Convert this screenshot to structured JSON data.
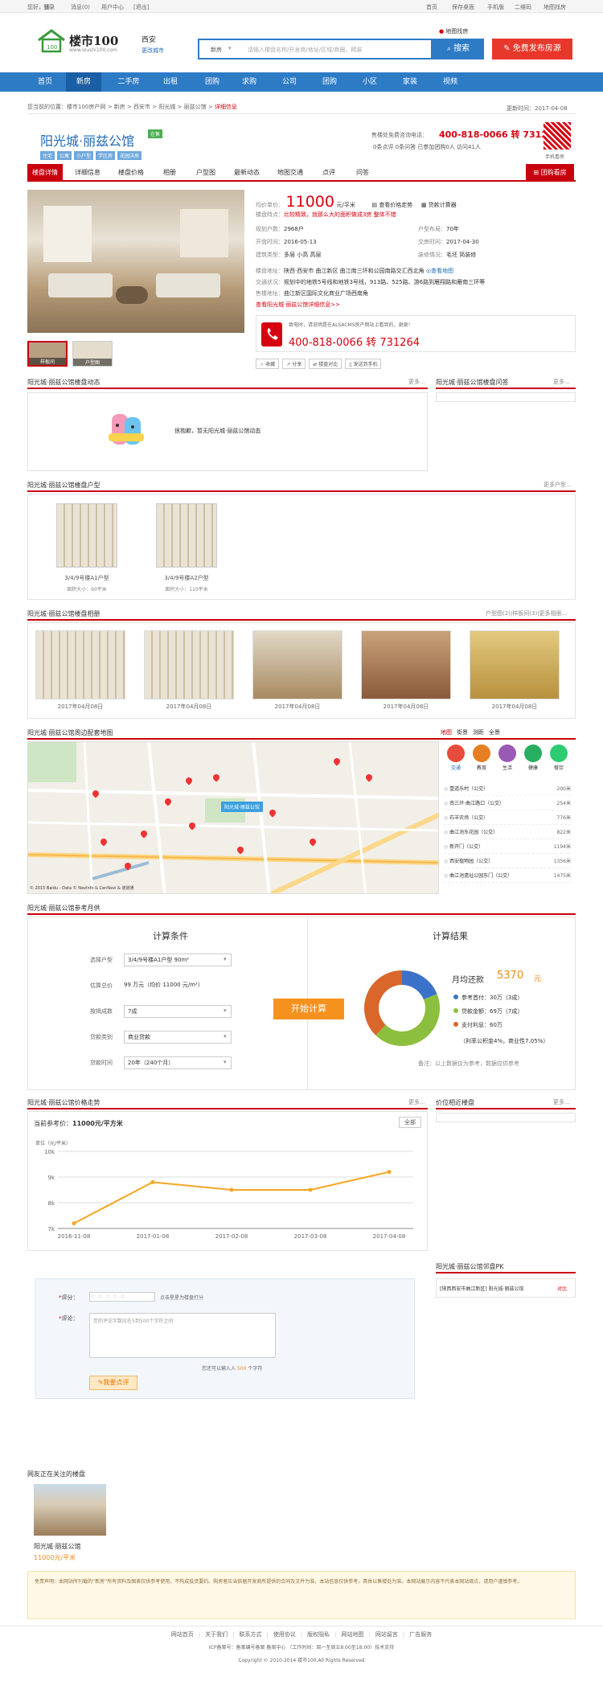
{
  "topbar": {
    "welcome": "您好，请",
    "login": "登录",
    "messages": "消息(0)",
    "user_center": "用户中心",
    "logout": "[退出]",
    "home": "首页",
    "save_desktop": "保存桌面",
    "mobile": "手机版",
    "qrcode": "二维码",
    "sitemap": "地图找房"
  },
  "header": {
    "logo_text": "楼市100",
    "logo_url": "www.loushi100.com",
    "city": "西安",
    "switch_city": "更改城市",
    "search_category": "新房",
    "search_placeholder": "请输入楼盘名称/开发商/地址/区域/商圈，精装",
    "search_button": "搜索",
    "map_search": "地图找房",
    "publish_button": "免费发布房源"
  },
  "nav": [
    "首页",
    "新房",
    "二手房",
    "出租",
    "团购",
    "求购",
    "公司",
    "团购",
    "小区",
    "家装",
    "视频"
  ],
  "breadcrumb": {
    "prefix": "您当前的位置：",
    "path": "楼市100房产网 > 新房 > 西安市 > 阳光城 > 丽兹公馆 >",
    "current": "详细信息",
    "updated": "更新时间：2017-04-08"
  },
  "title": {
    "name": "阳光城·丽兹公馆",
    "badge": "在售",
    "tags": [
      "住宅",
      "公寓",
      "小户型",
      "学区房",
      "花园洋房"
    ],
    "hotline_label": "售楼处免费咨询电话：",
    "hotline": "400-818-0066 转 731264",
    "stats": "0条点评 0条问答 已参加团购0人 访问41人",
    "qr_label": "手机看房"
  },
  "tabs": [
    "楼盘详情",
    "详细信息",
    "楼盘价格",
    "相册",
    "户型图",
    "最新动态",
    "地图交通",
    "点评",
    "问答"
  ],
  "group_buy_button": "团购看房",
  "gallery": {
    "thumbs": [
      "样板间",
      "户型图"
    ]
  },
  "info": {
    "price_label": "均价单价：",
    "price": "11000",
    "price_unit": "元/平米",
    "trend_link": "查看价格走势",
    "calc_link": "贷款计算器",
    "feature_label": "楼盘特点：",
    "feature": "比较精致，就那么大的面积做成3房 整体不错",
    "rows": [
      [
        "规划户数：",
        "2968户",
        "户型布局：",
        "70年"
      ],
      [
        "开盘时间：",
        "2016-05-13",
        "交房时间：",
        "2017-04-30"
      ],
      [
        "建筑类型：",
        "多层 小高 高层",
        "装修情况：",
        "毛坯 简装修"
      ]
    ],
    "address_label": "楼盘地址：",
    "address": "陕西·西安市 曲江新区 曲江南三环和公园南路交汇西北角",
    "map_link": "查看地图",
    "traffic_label": "交通状况：",
    "traffic": "规划中的地铁5号线和地铁3号线，913路、525路、游6路到雁翔路和雁南三环等",
    "sales_label": "售楼地址：",
    "sales": "曲江新区国际文化商业广场西南角",
    "more_link": "查看阳光城·丽兹公馆详细信息>>"
  },
  "phone_card": {
    "note": "致电时，请说明是在ALSACMS房产网站上看到的，谢谢！",
    "number": "400-818-0066 转 731264"
  },
  "actions": [
    "收藏",
    "分享",
    "楼盘对比",
    "发送到手机"
  ],
  "dynamics": {
    "title": "阳光城·丽兹公馆楼盘动态",
    "more": "更多...",
    "empty": "很抱歉，暂无阳光城·丽兹公馆动态"
  },
  "qa": {
    "title": "阳光城·丽兹公馆楼盘问答",
    "more": "更多..."
  },
  "floorplans": {
    "title": "阳光城·丽兹公馆楼盘户型",
    "more": "更多户型...",
    "items": [
      {
        "name": "3/4/9号楼A1户型",
        "area": "面积大小：90平米"
      },
      {
        "name": "3/4/9号楼A2户型",
        "area": "面积大小：110平米"
      }
    ]
  },
  "album": {
    "title": "阳光城·丽兹公馆楼盘相册",
    "more": "户型图(2)|样板间(3)|更多相册...",
    "dates": [
      "2017年04月08日",
      "2017年04月08日",
      "2017年04月08日",
      "2017年04月08日",
      "2017年04月08日"
    ]
  },
  "map": {
    "title": "阳光城·丽兹公馆周边配套地图",
    "modes": [
      "地图",
      "街景",
      "测距",
      "全景"
    ],
    "label": "阳光城·丽兹公馆",
    "categories": [
      "交通",
      "教育",
      "生活",
      "健康",
      "餐饮"
    ],
    "stations": [
      [
        "壹道乐村（公交）",
        "200米"
      ],
      [
        "南三环·曲江路口（公交）",
        "254米"
      ],
      [
        "石羊农场（公交）",
        "776米"
      ],
      [
        "曲江池东花园（公交）",
        "822米"
      ],
      [
        "新开门（公交）",
        "1194米"
      ],
      [
        "西安植物园（公交）",
        "1356米"
      ],
      [
        "曲江池遗址公园东门（公交）",
        "1475米"
      ]
    ],
    "copyright": "© 2015 Baidu - Data © NavInfo & CenNavi & 道道通"
  },
  "calc": {
    "title": "阳光城·丽兹公馆参考月供",
    "cond_title": "计算条件",
    "result_title": "计算结果",
    "fields": [
      [
        "选择户型",
        "3/4/9号楼A1户型 90m²"
      ],
      [
        "估算总价",
        "99 万元（均价 11000 元/m²）"
      ],
      [
        "按揭成数",
        "7成"
      ],
      [
        "贷款类别",
        "商业贷款"
      ],
      [
        "贷款时间",
        "20年（240个月）"
      ]
    ],
    "button": "开始计算",
    "monthly_label": "月均还款",
    "monthly": "5370",
    "monthly_unit": "元",
    "legend": [
      "参考首付：30万（3成）",
      "贷款金额：69万（7成）",
      "支付利息：60万"
    ],
    "rate": "（利率公积金4%，商业性7.05%）",
    "note": "备注：以上数据仅为参考，数据仅供参考"
  },
  "trend": {
    "title": "阳光城·丽兹公馆价格走势",
    "more": "更多...",
    "current_label": "当前参考价：",
    "current": "11000元/平方米",
    "all": "全部",
    "unit": "单位（元/平米）"
  },
  "chart_data": {
    "type": "line",
    "x": [
      "2016-11-08",
      "2017-01-08",
      "2017-02-08",
      "2017-03-08",
      "2017-04-08"
    ],
    "series": [
      {
        "values": [
          7200,
          8800,
          8500,
          8500,
          9200
        ]
      }
    ],
    "ylabel": "单位（元/平米）",
    "yticks": [
      "7k",
      "8k",
      "9k",
      "10k"
    ],
    "ylim": [
      7000,
      10000
    ]
  },
  "nearby": {
    "title": "价位相近楼盘",
    "more": "更多..."
  },
  "pk": {
    "title": "阳光城·丽兹公馆邻盘PK",
    "item": "[陕西西安市曲江新区] 阳光城·丽兹公馆",
    "compare": "对比"
  },
  "comment": {
    "score_label": "评分：",
    "score_hint": "点击星星为楼盘打分",
    "comment_label": "评论：",
    "placeholder": "您的评论字数应在5到500个字符之间",
    "remaining_prefix": "您还可以输入入",
    "remaining": "500",
    "remaining_suffix": "个字符",
    "submit": "我要点评"
  },
  "watching": {
    "title": "网友正在关注的楼盘",
    "name": "阳光城·丽兹公馆",
    "price": "11000元/平米"
  },
  "disclaimer": "免责声明：本网站所刊载的“新房”所有资料及图表仅供参考使用，不构成投资要约。购房者应当依据开发商所提供的合同及文件为准，本站信息仅供参考，具体以售楼处为准。本网站展示内容不代表本网站观点，请用户谨慎参考。",
  "footer": {
    "links": [
      "网站首页",
      "关于我们",
      "联系方式",
      "使用协议",
      "版权隐私",
      "网站地图",
      "网站留言",
      "广告服务"
    ],
    "icp": "ICP备案号：备案编号备案 备案中心",
    "service": "（工作时间：周一至周五8:00至18:00）技术支持",
    "copyright": "Copyright © 2010-2014 楼市100.All Rights Reserved"
  }
}
